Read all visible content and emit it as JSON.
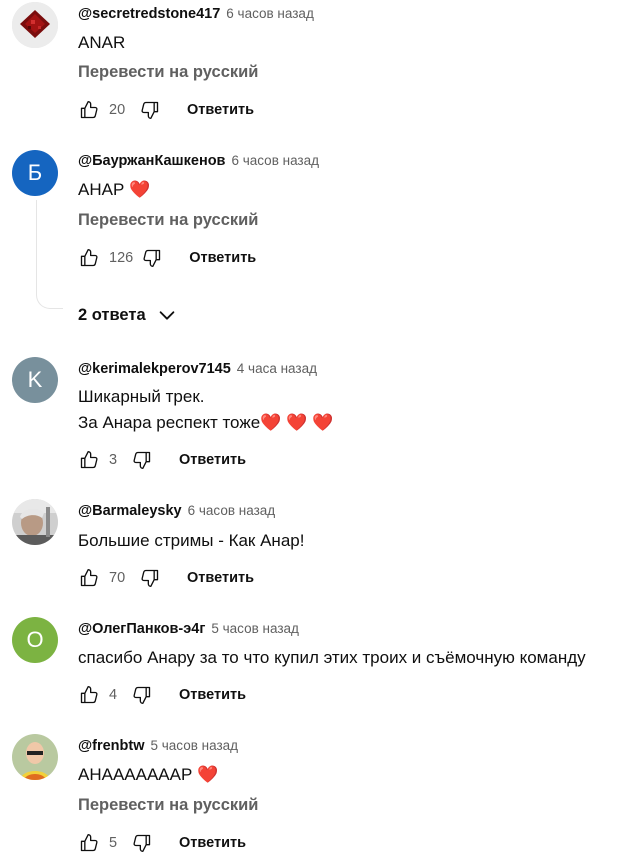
{
  "comments": [
    {
      "author": "@secretredstone417",
      "time": "6 часов назад",
      "lines": [
        "ANAR"
      ],
      "translate": "Перевести на русский",
      "likes": "20",
      "reply": "Ответить",
      "avatar_color": "#d8d8d8"
    },
    {
      "author": "@БауржанКашкенов",
      "time": "6 часов назад",
      "lines": [
        "АНАР"
      ],
      "translate": "Перевести на русский",
      "likes": "126",
      "reply": "Ответить",
      "avatar_letter": "Б",
      "avatar_color": "#1565c0"
    },
    {
      "author": "@kerimalekperov7145",
      "time": "4 часа назад",
      "lines": [
        "Шикарный трек.",
        "За Анара респект тоже"
      ],
      "likes": "3",
      "reply": "Ответить",
      "avatar_letter": "K",
      "avatar_color": "#78909c"
    },
    {
      "author": "@Barmaleysky",
      "time": "6 часов назад",
      "lines": [
        "Большие стримы - Как Анар!"
      ],
      "likes": "70",
      "reply": "Ответить",
      "avatar_color": "#9e9e9e"
    },
    {
      "author": "@ОлегПанков-э4г",
      "time": "5 часов назад",
      "lines": [
        "спасибо Анару за то что купил этих троих и съёмочную команду"
      ],
      "likes": "4",
      "reply": "Ответить",
      "avatar_letter": "О",
      "avatar_color": "#7cb342"
    },
    {
      "author": "@frenbtw",
      "time": "5 часов назад",
      "lines": [
        "АНААААААAР"
      ],
      "translate": "Перевести на русский",
      "likes": "5",
      "reply": "Ответить",
      "avatar_color": "#a5b98c"
    }
  ],
  "replies_toggle": "2 ответа",
  "heart": "❤️"
}
